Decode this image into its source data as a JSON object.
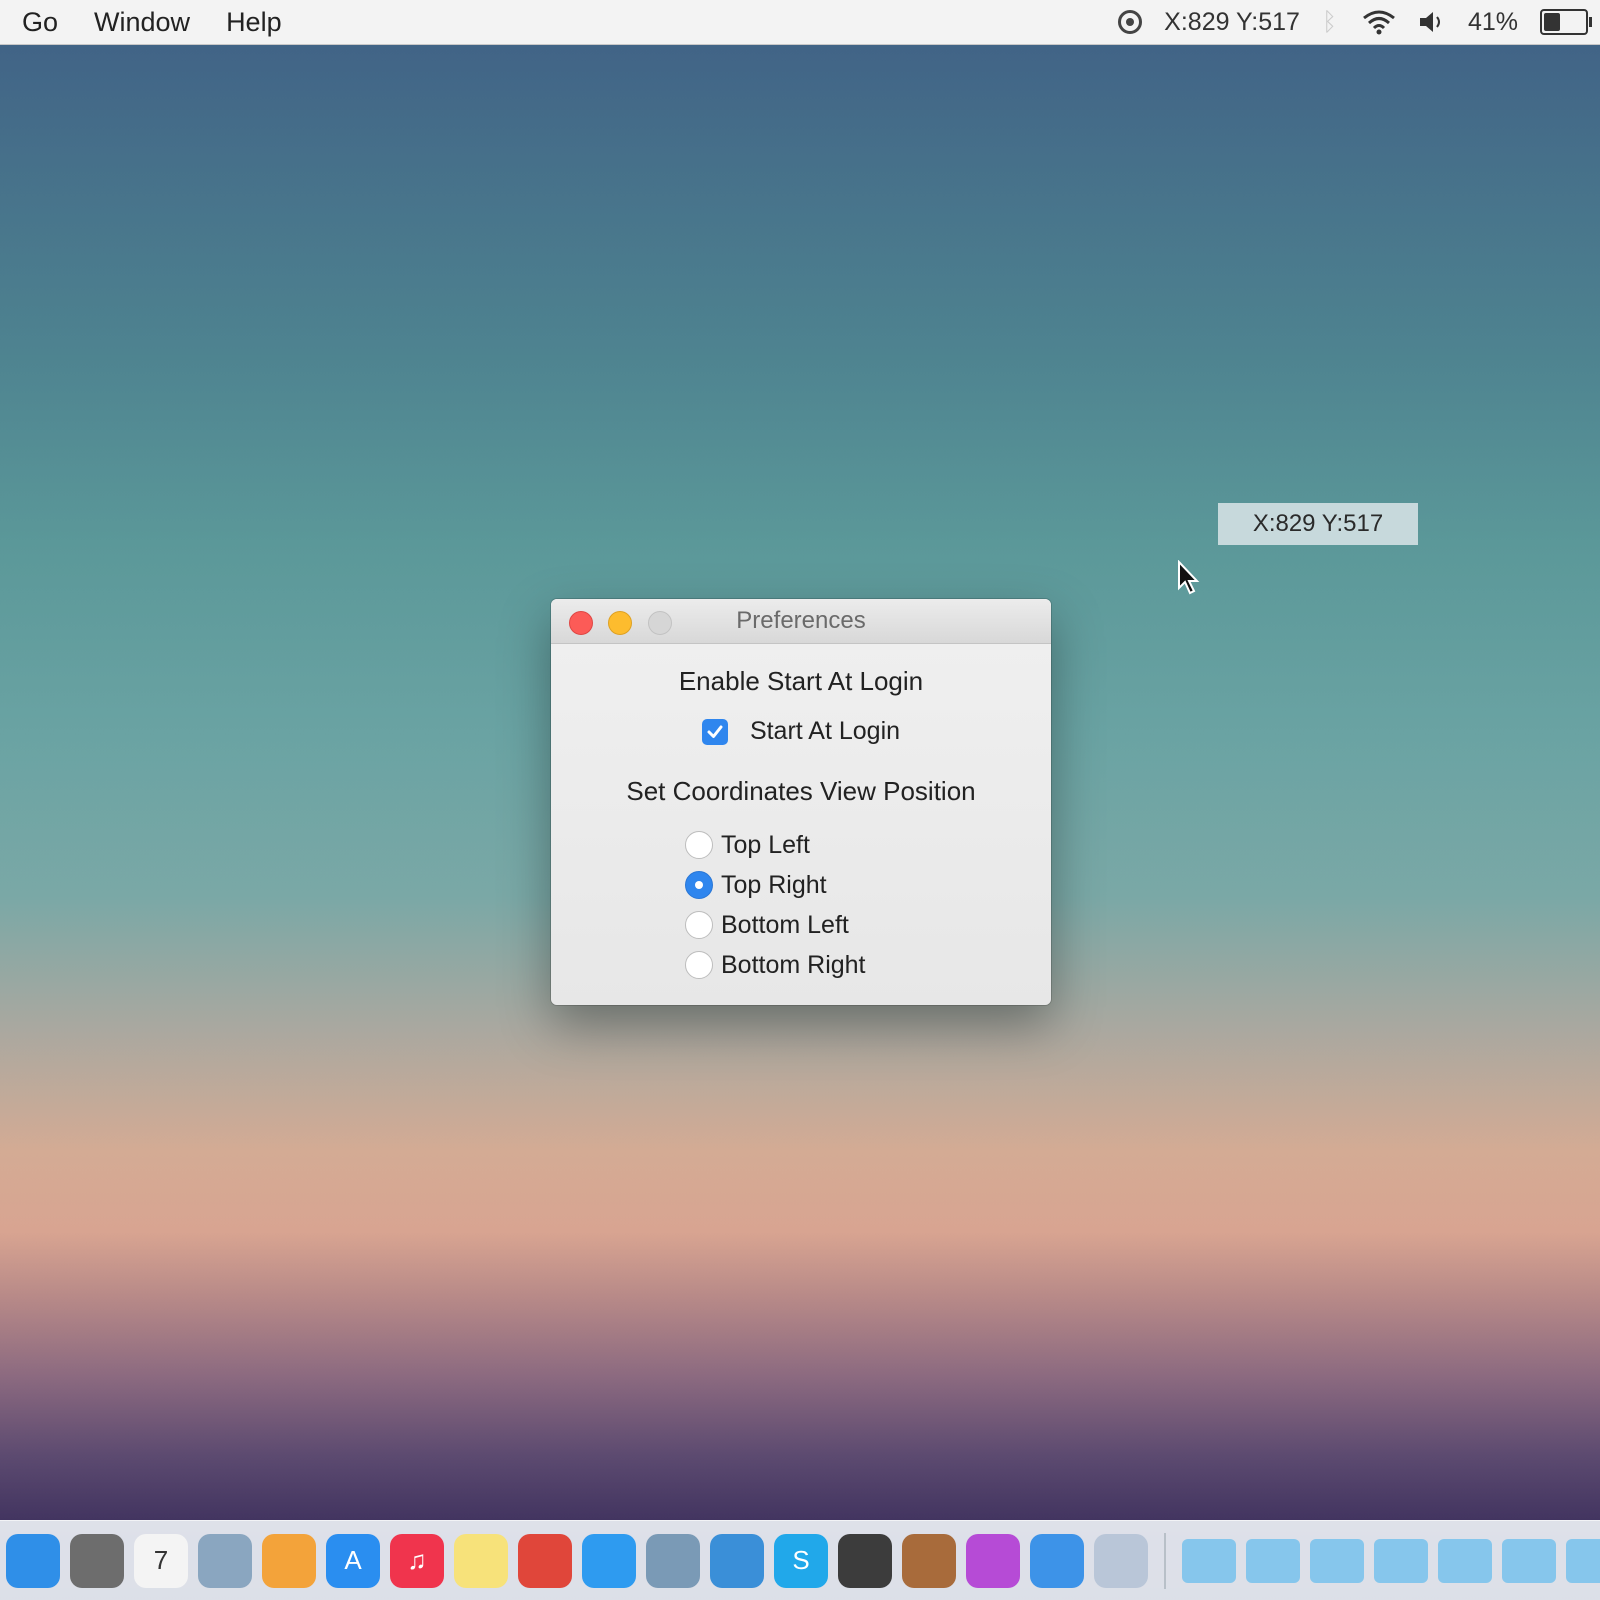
{
  "menubar": {
    "items": [
      "Go",
      "Window",
      "Help"
    ],
    "coordinates": "X:829 Y:517",
    "battery_percent": "41%",
    "battery_level": 0.41
  },
  "overlay": {
    "coordinates": "X:829 Y:517"
  },
  "window": {
    "title": "Preferences",
    "login_section_title": "Enable Start At Login",
    "start_at_login_label": "Start At Login",
    "start_at_login_checked": true,
    "position_section_title": "Set Coordinates View Position",
    "positions": [
      {
        "label": "Top Left",
        "selected": false
      },
      {
        "label": "Top Right",
        "selected": true
      },
      {
        "label": "Bottom Left",
        "selected": false
      },
      {
        "label": "Bottom Right",
        "selected": false
      }
    ]
  },
  "dock": {
    "apps": [
      {
        "name": "finder-icon",
        "color": "#2f8fe8"
      },
      {
        "name": "system-preferences-icon",
        "color": "#6d6d6d"
      },
      {
        "name": "calendar-icon",
        "color": "#f4f4f4",
        "text": "7"
      },
      {
        "name": "preview-icon",
        "color": "#8aa6c0"
      },
      {
        "name": "photos-icon",
        "color": "#f3a33a"
      },
      {
        "name": "app-store-icon",
        "color": "#2a8ef0",
        "text": "A"
      },
      {
        "name": "itunes-icon",
        "color": "#f0344d",
        "text": "♫"
      },
      {
        "name": "notes-icon",
        "color": "#f7e27a"
      },
      {
        "name": "chrome-icon",
        "color": "#e0463a"
      },
      {
        "name": "safari-icon",
        "color": "#2e9bf0"
      },
      {
        "name": "image-capture-icon",
        "color": "#7a9ab6"
      },
      {
        "name": "xcode-icon",
        "color": "#3a8fd8"
      },
      {
        "name": "skype-icon",
        "color": "#21a8ea",
        "text": "S"
      },
      {
        "name": "activity-monitor-icon",
        "color": "#3c3c3c"
      },
      {
        "name": "instruments-icon",
        "color": "#a86b3b"
      },
      {
        "name": "flower-app-icon",
        "color": "#b64bd6"
      },
      {
        "name": "dropbox-icon",
        "color": "#3d93e8"
      },
      {
        "name": "virtualbox-icon",
        "color": "#b9c6d8"
      }
    ],
    "stacks": [
      "applications-stack-icon",
      "documents-stack-icon",
      "downloads-stack-icon",
      "desktop-stack-icon",
      "folder-stack-icon",
      "folder-stack-icon-2",
      "trash-stack-icon"
    ]
  }
}
